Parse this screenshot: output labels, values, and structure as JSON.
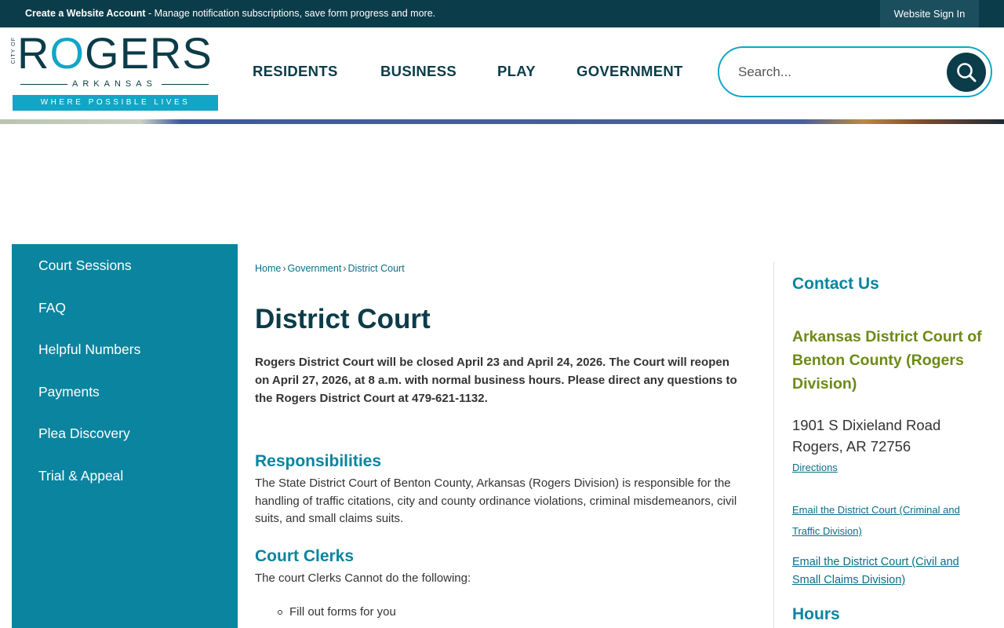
{
  "topbar": {
    "account_link": "Create a Website Account",
    "account_text": " - Manage notification subscriptions, save form progress and more.",
    "signin": "Website Sign In"
  },
  "logo": {
    "city_of": "CITY OF",
    "name_r": "R",
    "name_o": "O",
    "name_rest": "GERS",
    "state": "ARKANSAS",
    "tagline": "WHERE POSSIBLE LIVES"
  },
  "nav": {
    "items": [
      "RESIDENTS",
      "BUSINESS",
      "PLAY",
      "GOVERNMENT"
    ]
  },
  "search": {
    "placeholder": "Search..."
  },
  "sidebar": {
    "items": [
      "Court Sessions",
      "FAQ",
      "Helpful Numbers",
      "Payments",
      "Plea Discovery",
      "Trial & Appeal"
    ]
  },
  "breadcrumb": {
    "items": [
      "Home",
      "Government",
      "District Court"
    ]
  },
  "main": {
    "title": "District Court",
    "notice": "Rogers District Court will be closed April 23 and April 24, 2026. The Court will reopen on April 27, 2026, at 8 a.m. with normal business hours. Please direct any questions to the Rogers District Court at 479-621-1132.",
    "responsibilities_heading": "Responsibilities",
    "responsibilities_text": "The State District Court of Benton County, Arkansas (Rogers Division) is responsible for the handling of traffic citations, city and county ordinance violations, criminal misdemeanors, civil suits, and small claims suits.",
    "clerks_heading": "Court Clerks",
    "clerks_text": "The court Clerks Cannot do the following:",
    "clerks_bullets": [
      "Fill out forms for you"
    ]
  },
  "contact": {
    "heading": "Contact Us",
    "org": "Arkansas District Court of Benton County (Rogers Division)",
    "address_line1": "1901 S Dixieland Road",
    "address_line2": "Rogers, AR 72756",
    "directions": "Directions",
    "email_criminal_line1": "Email the District Court (Criminal and",
    "email_criminal_line2": "Traffic Division)",
    "email_civil_line1": "Email the District Court (Civil and",
    "email_civil_line2": "Small Claims Division)",
    "hours_heading": "Hours"
  },
  "colors": {
    "dark_teal": "#0b3c49",
    "accent_teal": "#0a849f",
    "logo_blue": "#12a5c6",
    "olive": "#6c8a17"
  },
  "icons": {
    "search": "search-icon"
  }
}
